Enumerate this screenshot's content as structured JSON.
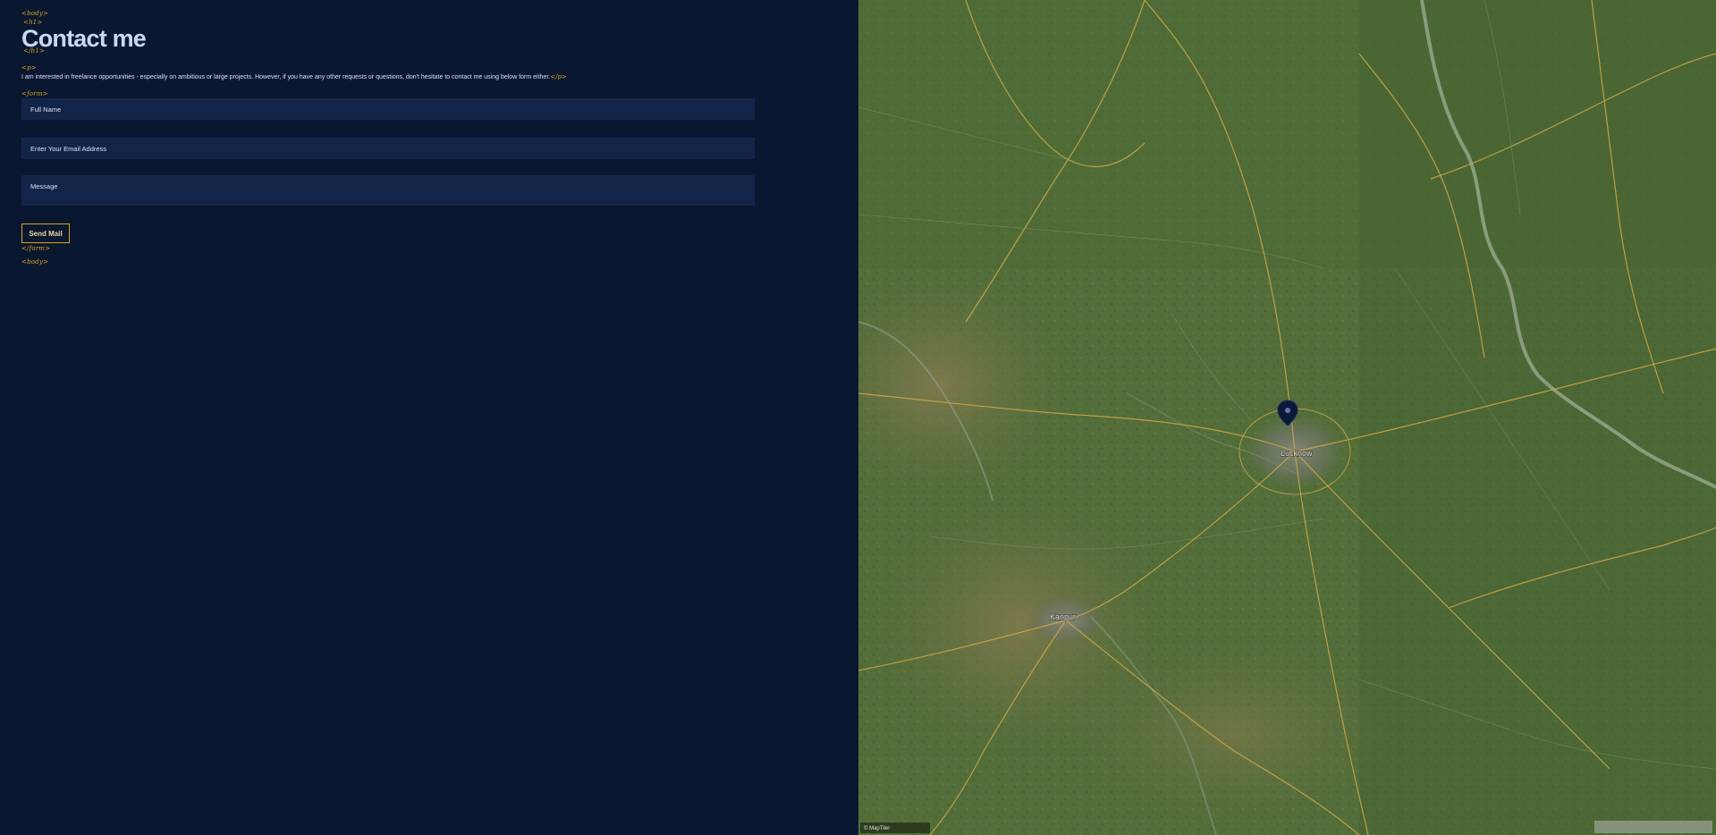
{
  "tags": {
    "body_open": "<body>",
    "h1_open": "<h1>",
    "h1_close": "</h1>",
    "p_open": "<p>",
    "p_close": "</p>",
    "form_open": "<form>",
    "form_close": "</form>",
    "body_close": "<body>"
  },
  "contact": {
    "title": "Contact me",
    "intro": "I am interested in freelance opportunities - especially on ambitious or large projects. However, if you have any other requests or questions, don't hesitate to contact me using below form either."
  },
  "form": {
    "name_placeholder": "Full Name",
    "email_placeholder": "Enter Your Email Address",
    "message_placeholder": "Message",
    "send_label": "Send Mail"
  },
  "map": {
    "main_city": "Lucknow",
    "second_city": "Kanpur",
    "attribution": "© MapTiler",
    "marker_icon": "location-pin-icon",
    "colors": {
      "land": "#4f6a36",
      "road": "#c9a54a",
      "river": "#8aa090",
      "marker": "#0a1a3a"
    }
  },
  "colors": {
    "background": "#0a1730",
    "accent": "#d6a51f",
    "title": "#c8d8f5",
    "field_bg": "#132449"
  }
}
